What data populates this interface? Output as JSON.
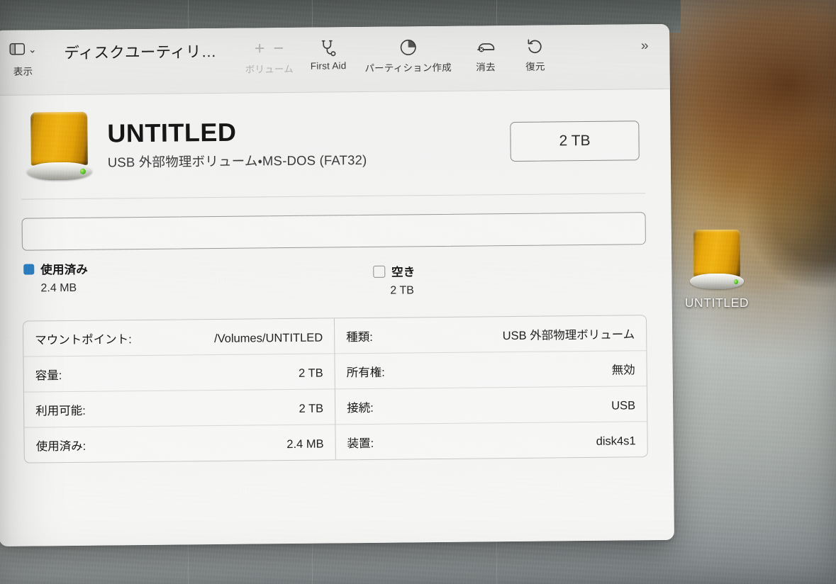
{
  "window": {
    "title": "ディスクユーティリ…"
  },
  "toolbar": {
    "view": {
      "label": "表示",
      "icon": "sidebar-icon",
      "chevron": "⌄"
    },
    "volume": {
      "label": "ボリューム",
      "add": "+",
      "remove": "−",
      "disabled": true
    },
    "first_aid": {
      "label": "First Aid",
      "icon": "stethoscope-icon"
    },
    "partition": {
      "label": "パーティション作成",
      "icon": "pie-chart-icon"
    },
    "erase": {
      "label": "消去",
      "icon": "eraser-icon"
    },
    "restore": {
      "label": "復元",
      "icon": "undo-icon"
    },
    "overflow": {
      "label": "»"
    }
  },
  "volume": {
    "name": "UNTITLED",
    "subtitle": "USB 外部物理ボリューム・MS-DOS (FAT32)",
    "capacity_badge": "2 TB"
  },
  "usage": {
    "used_percent": 0,
    "legend": [
      {
        "key": "used",
        "label": "使用済み",
        "value": "2.4 MB",
        "color": "#2b82c6",
        "filled": true
      },
      {
        "key": "free",
        "label": "空き",
        "value": "2 TB",
        "color": "#8e8e8c",
        "filled": false
      }
    ]
  },
  "info": {
    "left": [
      {
        "key": "マウントポイント:",
        "value": "/Volumes/UNTITLED"
      },
      {
        "key": "容量:",
        "value": "2 TB"
      },
      {
        "key": "利用可能:",
        "value": "2 TB"
      },
      {
        "key": "使用済み:",
        "value": "2.4 MB"
      }
    ],
    "right": [
      {
        "key": "種類:",
        "value": "USB 外部物理ボリューム"
      },
      {
        "key": "所有権:",
        "value": "無効"
      },
      {
        "key": "接続:",
        "value": "USB"
      },
      {
        "key": "装置:",
        "value": "disk4s1"
      }
    ]
  },
  "desktop": {
    "icon_label": "UNTITLED"
  }
}
